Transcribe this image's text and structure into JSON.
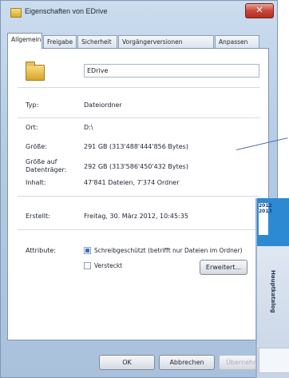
{
  "window": {
    "title": "Eigenschaften von EDrive",
    "close_glyph": "✕"
  },
  "tabs": [
    {
      "label": "Allgemein"
    },
    {
      "label": "Freigabe"
    },
    {
      "label": "Sicherheit"
    },
    {
      "label": "Vorgängerversionen"
    },
    {
      "label": "Anpassen"
    }
  ],
  "general": {
    "name": "EDrive",
    "type_label": "Typ:",
    "type_value": "Dateiordner",
    "location_label": "Ort:",
    "location_value": "D:\\",
    "size_label": "Größe:",
    "size_value": "291 GB (313'488'444'856 Bytes)",
    "size_on_disk_label": "Größe auf Datenträger:",
    "size_on_disk_value": "292 GB (313'586'450'432 Bytes)",
    "contents_label": "Inhalt:",
    "contents_value": "47'841 Dateien, 7'374 Ordner",
    "created_label": "Erstellt:",
    "created_value": "Freitag, 30. März 2012, 10:45:35",
    "attributes_label": "Attribute:",
    "readonly_label": "Schreibgeschützt (betrifft nur Dateien im Ordner)",
    "hidden_label": "Versteckt",
    "advanced_button": "Erweitert..."
  },
  "buttons": {
    "ok": "OK",
    "cancel": "Abbrechen",
    "apply": "Übernehmen"
  },
  "ad": {
    "badge_text": "2012 2013",
    "side_text": "Hauptkatalog"
  },
  "colors": {
    "accent": "#2c8ad3",
    "arrow": "#4d6fb2"
  }
}
